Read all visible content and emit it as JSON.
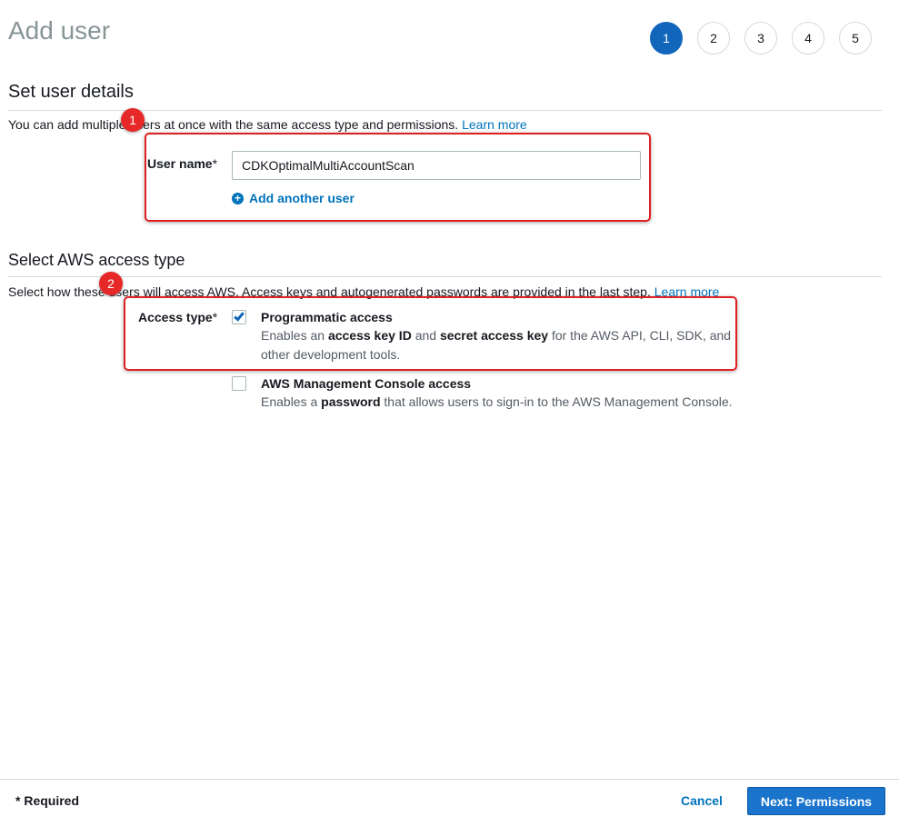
{
  "page": {
    "title": "Add user"
  },
  "steps": [
    "1",
    "2",
    "3",
    "4",
    "5"
  ],
  "user_details": {
    "title": "Set user details",
    "description": "You can add multiple users at once with the same access type and permissions.",
    "learn_more": "Learn more",
    "user_name_label": "User name",
    "required_marker": "*",
    "user_name_value": "CDKOptimalMultiAccountScan",
    "add_another": "Add another user"
  },
  "access_type": {
    "title": "Select AWS access type",
    "description": "Select how these users will access AWS. Access keys and autogenerated passwords are provided in the last step.",
    "learn_more": "Learn more",
    "label": "Access type",
    "required_marker": "*",
    "programmatic": {
      "title": "Programmatic access",
      "checked": true,
      "desc_1": "Enables an ",
      "desc_b1": "access key ID",
      "desc_2": " and ",
      "desc_b2": "secret access key",
      "desc_3": " for the AWS API, CLI, SDK, and other development tools."
    },
    "console": {
      "title": "AWS Management Console access",
      "checked": false,
      "desc_1": "Enables a ",
      "desc_b1": "password",
      "desc_2": " that allows users to sign-in to the AWS Management Console."
    }
  },
  "annotations": [
    "1",
    "2"
  ],
  "footer": {
    "required_note": "* Required",
    "cancel": "Cancel",
    "next": "Next: Permissions"
  },
  "colors": {
    "accent": "#1166bb",
    "link": "#0073bb",
    "highlight": "#e02020"
  }
}
